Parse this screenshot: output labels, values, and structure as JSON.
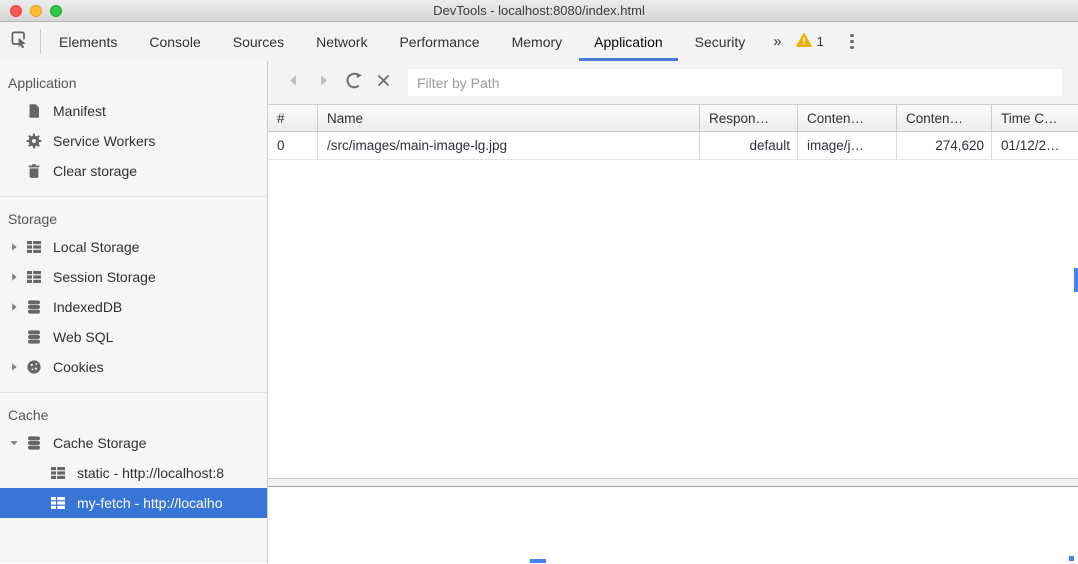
{
  "window": {
    "title": "DevTools - localhost:8080/index.html"
  },
  "tabbar": {
    "tabs": [
      {
        "label": "Elements"
      },
      {
        "label": "Console"
      },
      {
        "label": "Sources"
      },
      {
        "label": "Network"
      },
      {
        "label": "Performance"
      },
      {
        "label": "Memory"
      },
      {
        "label": "Application"
      },
      {
        "label": "Security"
      }
    ],
    "active_tab": "Application",
    "overflow_glyph": "»",
    "warning_count": "1"
  },
  "sidebar": {
    "sections": [
      {
        "title": "Application",
        "items": [
          {
            "label": "Manifest",
            "icon": "document-icon"
          },
          {
            "label": "Service Workers",
            "icon": "gear-icon"
          },
          {
            "label": "Clear storage",
            "icon": "trash-icon"
          }
        ]
      },
      {
        "title": "Storage",
        "items": [
          {
            "label": "Local Storage",
            "icon": "table-icon",
            "expandable": true
          },
          {
            "label": "Session Storage",
            "icon": "table-icon",
            "expandable": true
          },
          {
            "label": "IndexedDB",
            "icon": "database-icon",
            "expandable": true
          },
          {
            "label": "Web SQL",
            "icon": "database-icon",
            "expandable": false
          },
          {
            "label": "Cookies",
            "icon": "cookie-icon",
            "expandable": true
          }
        ]
      },
      {
        "title": "Cache",
        "items": [
          {
            "label": "Cache Storage",
            "icon": "database-icon",
            "expanded": true,
            "children": [
              {
                "label": "static - http://localhost:8",
                "icon": "table-icon",
                "selected": false
              },
              {
                "label": "my-fetch - http://localho",
                "icon": "table-icon",
                "selected": true
              }
            ]
          }
        ]
      }
    ]
  },
  "toolbar": {
    "filter_placeholder": "Filter by Path"
  },
  "table": {
    "columns": [
      {
        "label": "#"
      },
      {
        "label": "Name"
      },
      {
        "label": "Respon…"
      },
      {
        "label": "Conten…"
      },
      {
        "label": "Conten…"
      },
      {
        "label": "Time C…"
      }
    ],
    "rows": [
      [
        "0",
        "/src/images/main-image-lg.jpg",
        "default",
        "image/j…",
        "274,620",
        "01/12/2…"
      ]
    ]
  },
  "colors": {
    "accent": "#4879d8",
    "selection": "#3875d7",
    "warning": "#f0b000"
  }
}
